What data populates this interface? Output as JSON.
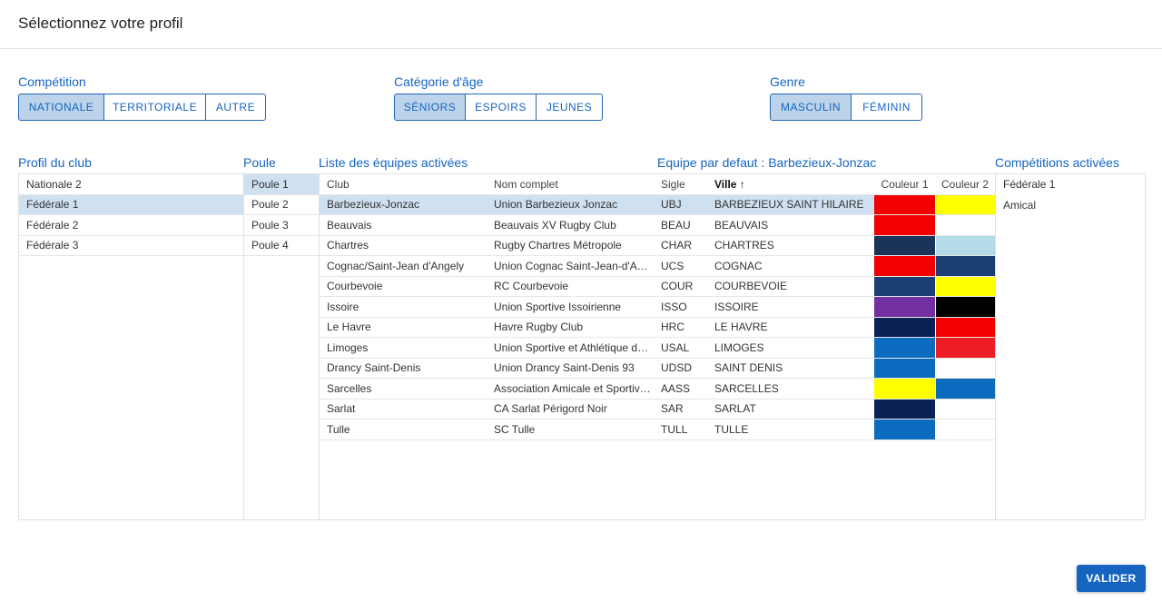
{
  "dialog": {
    "title": "Sélectionnez votre profil"
  },
  "filters": {
    "competition": {
      "label": "Compétition",
      "options": [
        "NATIONALE",
        "TERRITORIALE",
        "AUTRE"
      ],
      "selected": 0
    },
    "categorie": {
      "label": "Catégorie d'âge",
      "options": [
        "SÉNIORS",
        "ESPOIRS",
        "JEUNES"
      ],
      "selected": 0
    },
    "genre": {
      "label": "Genre",
      "options": [
        "MASCULIN",
        "FÉMININ"
      ],
      "selected": 0
    }
  },
  "profil": {
    "label": "Profil du club",
    "items": [
      "Nationale 2",
      "Fédérale 1",
      "Fédérale 2",
      "Fédérale 3"
    ],
    "selected": 1
  },
  "poule": {
    "label": "Poule",
    "items": [
      "Poule 1",
      "Poule 2",
      "Poule 3",
      "Poule 4"
    ],
    "selected": 0
  },
  "equipes": {
    "label": "Liste des équipes activées",
    "default_label": "Equipe par defaut : Barbezieux-Jonzac",
    "columns": {
      "club": "Club",
      "nom": "Nom complet",
      "sigle": "Sigle",
      "ville": "Ville",
      "sort_arrow": "↑",
      "couleur1": "Couleur 1",
      "couleur2": "Couleur 2"
    },
    "rows": [
      {
        "club": "Barbezieux-Jonzac",
        "nom": "Union Barbezieux Jonzac",
        "sigle": "UBJ",
        "ville": "BARBEZIEUX SAINT HILAIRE",
        "c1": "#f20000",
        "c2": "#ffff00"
      },
      {
        "club": "Beauvais",
        "nom": "Beauvais XV Rugby Club",
        "sigle": "BEAU",
        "ville": "BEAUVAIS",
        "c1": "#f20000",
        "c2": "#ffffff"
      },
      {
        "club": "Chartres",
        "nom": "Rugby Chartres Métropole",
        "sigle": "CHAR",
        "ville": "CHARTRES",
        "c1": "#1a3358",
        "c2": "#b3dbe8"
      },
      {
        "club": "Cognac/Saint-Jean d'Angely",
        "nom": "Union Cognac Saint-Jean-d'Angély",
        "sigle": "UCS",
        "ville": "COGNAC",
        "c1": "#f20000",
        "c2": "#1c3f73"
      },
      {
        "club": "Courbevoie",
        "nom": "RC Courbevoie",
        "sigle": "COUR",
        "ville": "COURBEVOIE",
        "c1": "#1c3f73",
        "c2": "#ffff00"
      },
      {
        "club": "Issoire",
        "nom": "Union Sportive Issoirienne",
        "sigle": "ISSO",
        "ville": "ISSOIRE",
        "c1": "#7230a0",
        "c2": "#000000"
      },
      {
        "club": "Le Havre",
        "nom": "Havre Rugby Club",
        "sigle": "HRC",
        "ville": "LE HAVRE",
        "c1": "#0b2257",
        "c2": "#f20000"
      },
      {
        "club": "Limoges",
        "nom": "Union Sportive et Athlétique de Limoges",
        "sigle": "USAL",
        "ville": "LIMOGES",
        "c1": "#0b6bbf",
        "c2": "#ee1c25"
      },
      {
        "club": "Drancy Saint-Denis",
        "nom": "Union Drancy Saint-Denis 93",
        "sigle": "UDSD",
        "ville": "SAINT DENIS",
        "c1": "#0b6bbf",
        "c2": "#ffffff"
      },
      {
        "club": "Sarcelles",
        "nom": "Association Amicale et Sportive de Sarcelles",
        "sigle": "AASS",
        "ville": "SARCELLES",
        "c1": "#ffff00",
        "c2": "#0b6bbf"
      },
      {
        "club": "Sarlat",
        "nom": "CA Sarlat Périgord Noir",
        "sigle": "SAR",
        "ville": "SARLAT",
        "c1": "#0b2257",
        "c2": "#ffffff"
      },
      {
        "club": "Tulle",
        "nom": "SC Tulle",
        "sigle": "TULL",
        "ville": "TULLE",
        "c1": "#0b6bbf",
        "c2": "#ffffff"
      }
    ],
    "selected": 0
  },
  "competitions": {
    "label": "Compétitions activées",
    "items": [
      "Fédérale 1",
      "Amical"
    ]
  },
  "footer": {
    "valider_label": "VALIDER"
  }
}
